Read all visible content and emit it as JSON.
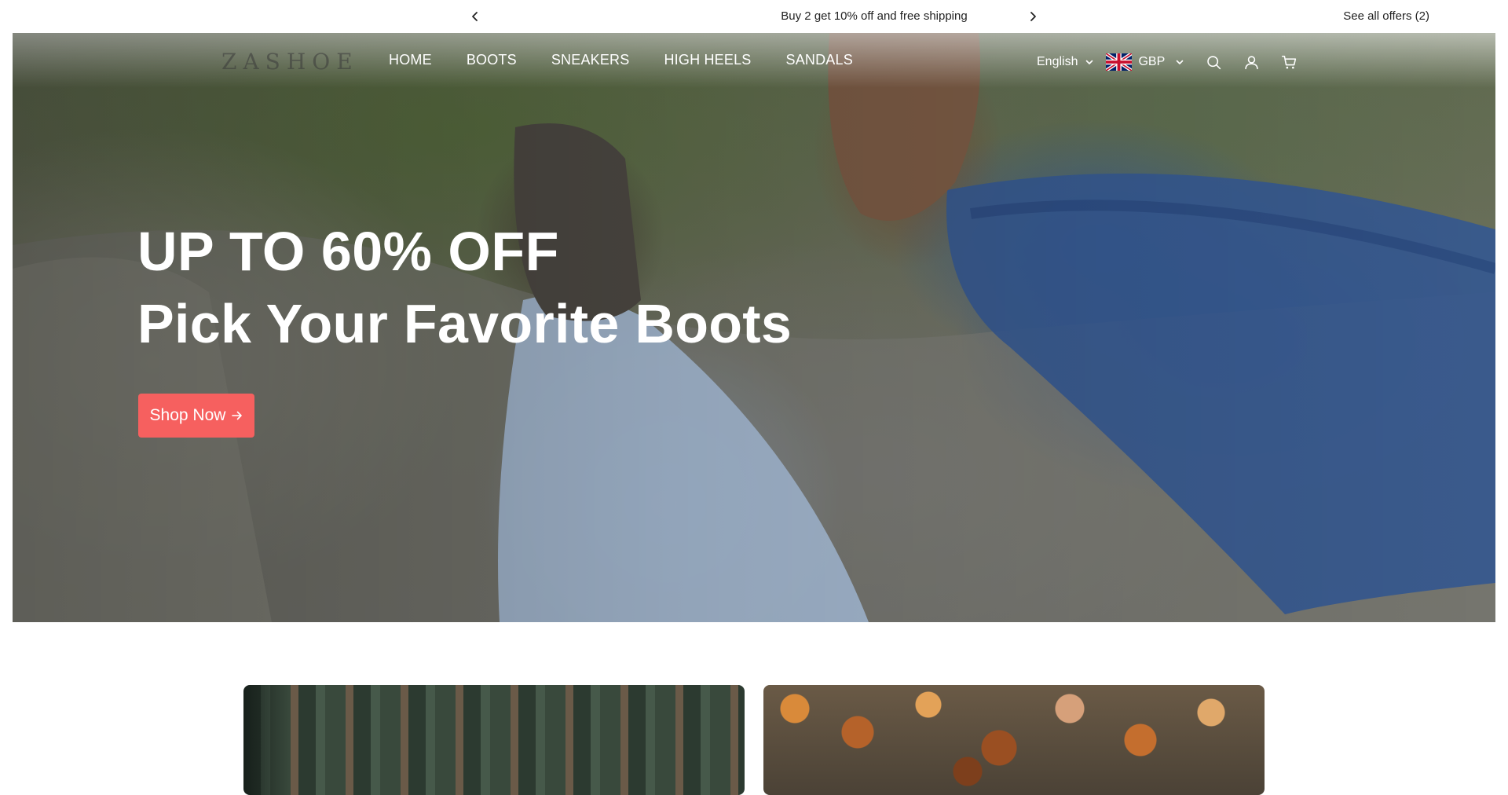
{
  "announcement": {
    "message": "Buy 2 get 10% off and free shipping",
    "offers_link": "See all offers (2)"
  },
  "header": {
    "logo": "ZASHOE",
    "nav": [
      "HOME",
      "BOOTS",
      "SNEAKERS",
      "HIGH HEELS",
      "SANDALS"
    ],
    "language": "English",
    "currency": "GBP"
  },
  "hero": {
    "headline": "UP TO 60% OFF",
    "subheadline": "Pick Your Favorite Boots",
    "cta": "Shop Now"
  },
  "colors": {
    "accent": "#f6605f",
    "announcement_bg": "#ffffff",
    "nav_text": "#ffffff"
  },
  "icons": [
    "chevron-left-icon",
    "chevron-right-icon",
    "chevron-down-icon",
    "uk-flag-icon",
    "search-icon",
    "user-icon",
    "cart-icon",
    "arrow-right-icon"
  ]
}
